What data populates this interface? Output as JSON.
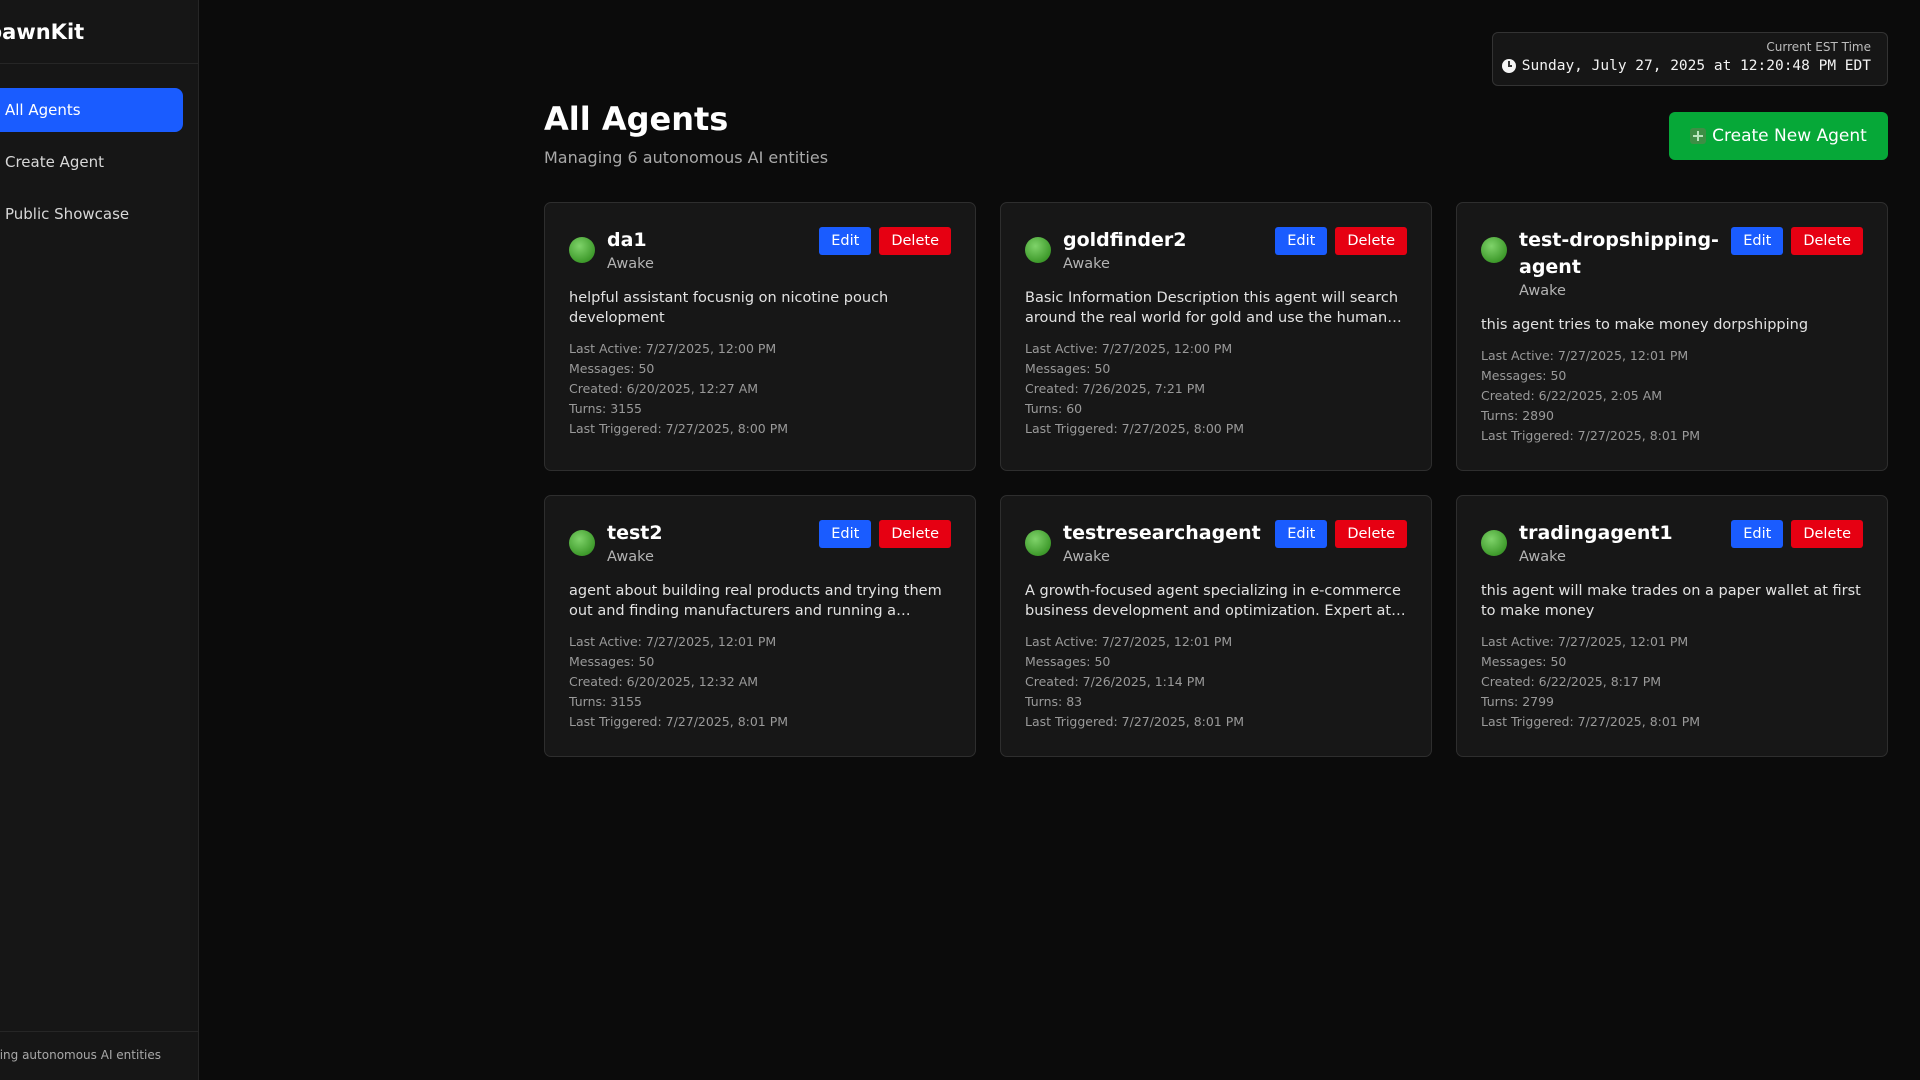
{
  "sidebar": {
    "brand": "SpawnKit",
    "items": [
      {
        "label": "All Agents",
        "active": true
      },
      {
        "label": "Create Agent",
        "active": false
      },
      {
        "label": "Public Showcase",
        "active": false
      }
    ],
    "footer": "Managing autonomous AI entities"
  },
  "clock": {
    "label": "Current EST Time",
    "time": "Sunday, July 27, 2025 at 12:20:48 PM EDT"
  },
  "header": {
    "title": "All Agents",
    "subtitle": "Managing 6 autonomous AI entities",
    "create_label": "Create New Agent"
  },
  "labels": {
    "edit": "Edit",
    "delete": "Delete"
  },
  "agents": [
    {
      "name": "da1",
      "status": "Awake",
      "description": "helpful assistant focusnig on nicotine pouch development",
      "last_active": "Last Active: 7/27/2025, 12:00 PM",
      "messages": "Messages: 50",
      "created": "Created: 6/20/2025, 12:27 AM",
      "turns": "Turns: 3155",
      "last_triggered": "Last Triggered: 7/27/2025, 8:00 PM"
    },
    {
      "name": "goldfinder2",
      "status": "Awake",
      "description": "Basic Information Description this agent will search around the real world for gold and use the human resources available to acquire it",
      "last_active": "Last Active: 7/27/2025, 12:00 PM",
      "messages": "Messages: 50",
      "created": "Created: 7/26/2025, 7:21 PM",
      "turns": "Turns: 60",
      "last_triggered": "Last Triggered: 7/27/2025, 8:00 PM"
    },
    {
      "name": "test-dropshipping-agent",
      "status": "Awake",
      "description": "this agent tries to make money dorpshipping",
      "last_active": "Last Active: 7/27/2025, 12:01 PM",
      "messages": "Messages: 50",
      "created": "Created: 6/22/2025, 2:05 AM",
      "turns": "Turns: 2890",
      "last_triggered": "Last Triggered: 7/27/2025, 8:01 PM"
    },
    {
      "name": "test2",
      "status": "Awake",
      "description": "agent about building real products and trying them out and finding manufacturers and running a business end to end",
      "last_active": "Last Active: 7/27/2025, 12:01 PM",
      "messages": "Messages: 50",
      "created": "Created: 6/20/2025, 12:32 AM",
      "turns": "Turns: 3155",
      "last_triggered": "Last Triggered: 7/27/2025, 8:01 PM"
    },
    {
      "name": "testresearchagent",
      "status": "Awake",
      "description": "A growth-focused agent specializing in e-commerce business development and optimization. Expert at research and analysis",
      "last_active": "Last Active: 7/27/2025, 12:01 PM",
      "messages": "Messages: 50",
      "created": "Created: 7/26/2025, 1:14 PM",
      "turns": "Turns: 83",
      "last_triggered": "Last Triggered: 7/27/2025, 8:01 PM"
    },
    {
      "name": "tradingagent1",
      "status": "Awake",
      "description": "this agent will make trades on a paper wallet at first to make money",
      "last_active": "Last Active: 7/27/2025, 12:01 PM",
      "messages": "Messages: 50",
      "created": "Created: 6/22/2025, 8:17 PM",
      "turns": "Turns: 2799",
      "last_triggered": "Last Triggered: 7/27/2025, 8:01 PM"
    }
  ]
}
